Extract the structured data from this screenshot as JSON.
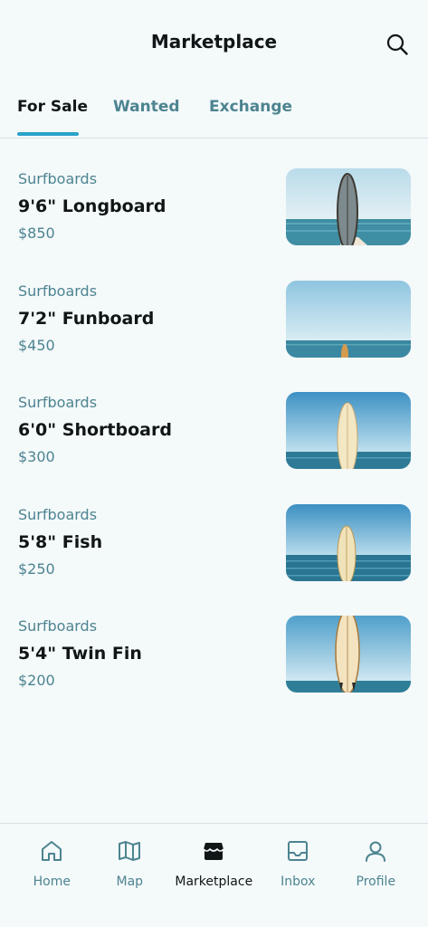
{
  "header": {
    "title": "Marketplace",
    "search_icon": "search-icon"
  },
  "tabs": [
    {
      "label": "For Sale",
      "active": true
    },
    {
      "label": "Wanted",
      "active": false
    },
    {
      "label": "Exchange",
      "active": false
    }
  ],
  "listings": [
    {
      "category": "Surfboards",
      "name": "9'6\" Longboard",
      "price": "$850"
    },
    {
      "category": "Surfboards",
      "name": "7'2\" Funboard",
      "price": "$450"
    },
    {
      "category": "Surfboards",
      "name": "6'0\" Shortboard",
      "price": "$300"
    },
    {
      "category": "Surfboards",
      "name": "5'8\" Fish",
      "price": "$250"
    },
    {
      "category": "Surfboards",
      "name": "5'4\" Twin Fin",
      "price": "$200"
    }
  ],
  "bottom_nav": [
    {
      "label": "Home",
      "icon": "home-icon",
      "active": false
    },
    {
      "label": "Map",
      "icon": "map-icon",
      "active": false
    },
    {
      "label": "Marketplace",
      "icon": "store-icon",
      "active": true
    },
    {
      "label": "Inbox",
      "icon": "inbox-icon",
      "active": false
    },
    {
      "label": "Profile",
      "icon": "profile-icon",
      "active": false
    }
  ],
  "colors": {
    "accent": "#2ba2c9",
    "muted_text": "#4d8490",
    "background": "#f4f9fa"
  }
}
